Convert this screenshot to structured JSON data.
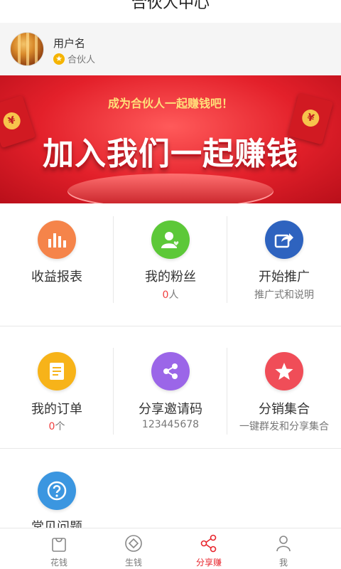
{
  "header": {
    "title": "合伙人中心"
  },
  "profile": {
    "username": "用户名",
    "role": "合伙人",
    "role_icon": "star-badge-icon"
  },
  "banner": {
    "subtitle": "成为合伙人一起赚钱吧！",
    "headline": "加入我们一起赚钱",
    "coin_symbol": "¥"
  },
  "grid": [
    {
      "label": "收益报表",
      "icon": "bar-chart-icon",
      "color": "#f5844a"
    },
    {
      "label": "我的粉丝",
      "icon": "user-heart-icon",
      "color": "#5cc838",
      "sub_num": "0",
      "sub_suffix": "人"
    },
    {
      "label": "开始推广",
      "icon": "share-arrow-icon",
      "color": "#2e63bf",
      "sub": "推广式和说明"
    },
    {
      "label": "我的订单",
      "icon": "document-icon",
      "color": "#f7b319",
      "sub_num": "0",
      "sub_suffix": "个"
    },
    {
      "label": "分享邀请码",
      "icon": "share-nodes-icon",
      "color": "#9b66e8",
      "sub": "123445678"
    },
    {
      "label": "分销集合",
      "icon": "star-icon",
      "color": "#f04d58",
      "sub": "一键群发和分享集合"
    },
    {
      "label": "常见问题",
      "icon": "question-icon",
      "color": "#3b96e0"
    }
  ],
  "tabbar": {
    "active_color": "#e8262d",
    "items": [
      {
        "label": "花钱",
        "icon": "shopping-bag-icon"
      },
      {
        "label": "生钱",
        "icon": "diamond-coin-icon"
      },
      {
        "label": "分享赚",
        "icon": "share-nodes-icon",
        "active": true
      },
      {
        "label": "我",
        "icon": "person-icon"
      }
    ]
  }
}
